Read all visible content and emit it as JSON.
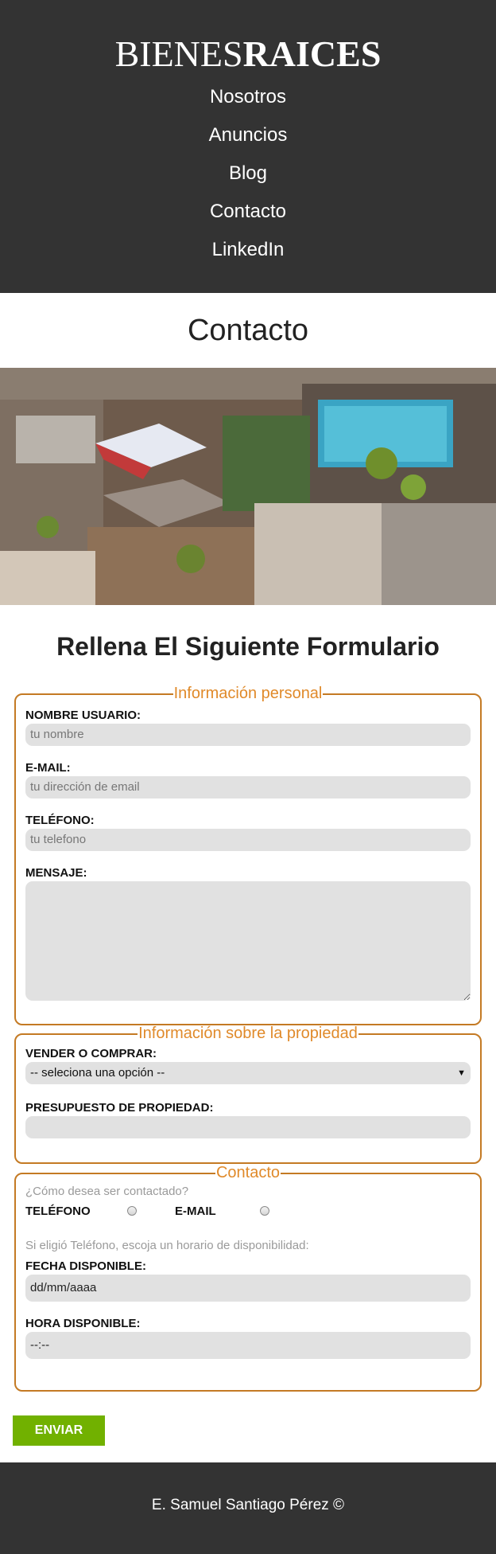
{
  "header": {
    "logo_light": "BIENES",
    "logo_bold": "RAICES",
    "nav": [
      "Nosotros",
      "Anuncios",
      "Blog",
      "Contacto",
      "LinkedIn"
    ]
  },
  "page_title": "Contacto",
  "form_title": "Rellena El Siguiente Formulario",
  "personal": {
    "legend": "Información personal",
    "name_label": "NOMBRE USUARIO:",
    "name_placeholder": "tu nombre",
    "email_label": "E-MAIL:",
    "email_placeholder": "tu dirección de email",
    "phone_label": "TELÉFONO:",
    "phone_placeholder": "tu telefono",
    "message_label": "MENSAJE:"
  },
  "property": {
    "legend": "Información sobre la propiedad",
    "buy_sell_label": "VENDER O COMPRAR:",
    "buy_sell_selected": "-- seleciona una opción --",
    "budget_label": "PRESUPUESTO DE PROPIEDAD:"
  },
  "contact": {
    "legend": "Contacto",
    "question": "¿Cómo desea ser contactado?",
    "option_phone": "TELÉFONO",
    "option_email": "E-MAIL",
    "hint": "Si eligió Teléfono, escoja un horario de disponibilidad:",
    "date_label": "FECHA DISPONIBLE:",
    "date_value": "dd/mm/aaaa",
    "time_label": "HORA DISPONIBLE:",
    "time_value": "--:--"
  },
  "submit_label": "Enviar",
  "footer": "E. Samuel Santiago Pérez ©",
  "colors": {
    "header_bg": "#333333",
    "accent": "#c47a24",
    "button": "#71b100"
  }
}
